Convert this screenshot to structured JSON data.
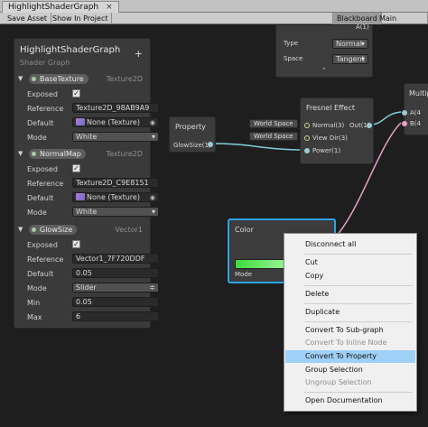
{
  "window": {
    "tab_title": "HighlightShaderGraph",
    "close_glyph": "×"
  },
  "toolbar": {
    "save_asset": "Save Asset",
    "show_in_project": "Show In Project",
    "blackboard": "Blackboard",
    "main_preview": "Main Preview"
  },
  "blackboard": {
    "title": "HighlightShaderGraph",
    "subtitle": "Shader Graph",
    "add_glyph": "+",
    "properties": [
      {
        "name": "BaseTexture",
        "type": "Texture2D",
        "exposed_label": "Exposed",
        "reference_label": "Reference",
        "reference": "Texture2D_98AB9A9",
        "default_label": "Default",
        "default": "None (Texture)",
        "mode_label": "Mode",
        "mode": "White"
      },
      {
        "name": "NormalMap",
        "type": "Texture2D",
        "exposed_label": "Exposed",
        "reference_label": "Reference",
        "reference": "Texture2D_C9E8151",
        "default_label": "Default",
        "default": "None (Texture)",
        "mode_label": "Mode",
        "mode": "White"
      },
      {
        "name": "GlowSize",
        "type": "Vector1",
        "exposed_label": "Exposed",
        "reference_label": "Reference",
        "reference": "Vector1_7F720DDF",
        "default_label": "Default",
        "default": "0.05",
        "mode_label": "Mode",
        "mode": "Slider",
        "min_label": "Min",
        "min": "0.05",
        "max_label": "Max",
        "max": "6"
      }
    ]
  },
  "nodes": {
    "top_node": {
      "output_label": "A(1)",
      "type_label": "Type",
      "type_value": "Normal",
      "space_label": "Space",
      "space_value": "Tangent"
    },
    "property_node": {
      "title": "Property",
      "output": "GlowSize(1)"
    },
    "fresnel_node": {
      "title": "Fresnel Effect",
      "inputs": [
        "Normal(3)",
        "View Dir(3)",
        "Power(1)"
      ],
      "output": "Out(1)",
      "chips": [
        "World Space",
        "World Space"
      ]
    },
    "multiply_node": {
      "title": "Multip",
      "inputs": [
        "A(4",
        "B(4"
      ]
    },
    "color_node": {
      "title": "Color",
      "mode_label": "Mode"
    }
  },
  "context_menu": {
    "items": [
      {
        "label": "Disconnect all",
        "enabled": true
      },
      {
        "label": "Cut",
        "enabled": true
      },
      {
        "label": "Copy",
        "enabled": true
      },
      {
        "label": "Delete",
        "enabled": true
      },
      {
        "label": "Duplicate",
        "enabled": true
      },
      {
        "label": "Convert To Sub-graph",
        "enabled": true
      },
      {
        "label": "Convert To Inline Node",
        "enabled": false
      },
      {
        "label": "Convert To Property",
        "enabled": true,
        "highlighted": true
      },
      {
        "label": "Group Selection",
        "enabled": true
      },
      {
        "label": "Ungroup Selection",
        "enabled": false
      },
      {
        "label": "Open Documentation",
        "enabled": true
      }
    ]
  },
  "icons": {
    "check": "✓",
    "expand_arrow": "▼",
    "texture": "texture-icon"
  },
  "colors": {
    "accent_selection": "#2ba3e6",
    "menu_highlight": "#9fd0f5",
    "edge_cyan": "#7fd0e0",
    "edge_pink": "#e7a0c5",
    "glow_green": "#3ddc3d"
  }
}
